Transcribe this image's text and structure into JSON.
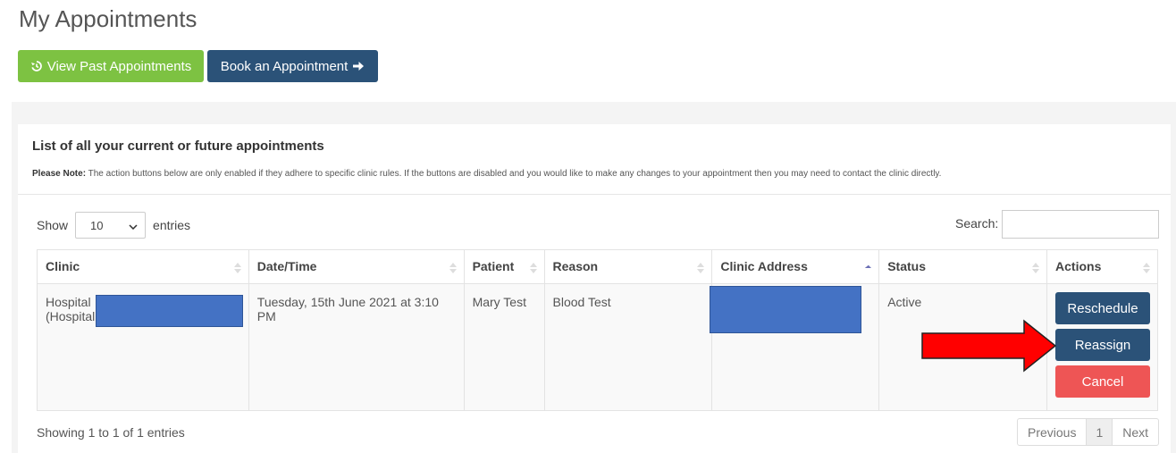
{
  "page": {
    "title": "My Appointments"
  },
  "toolbar": {
    "past_label": "View Past Appointments",
    "book_label": "Book an Appointment"
  },
  "panel": {
    "heading": "List of all your current or future appointments",
    "note_label": "Please Note:",
    "note_text": " The action buttons below are only enabled if they adhere to specific clinic rules. If the buttons are disabled and you would like to make any changes to your appointment then you may need to contact the clinic directly."
  },
  "length": {
    "show_label": "Show",
    "value": "10",
    "entries_label": "entries"
  },
  "search": {
    "label": "Search:",
    "value": ""
  },
  "table": {
    "columns": [
      "Clinic",
      "Date/Time",
      "Patient",
      "Reason",
      "Clinic Address",
      "Status",
      "Actions"
    ],
    "rows": [
      {
        "clinic_line1": "Hospital",
        "clinic_line2": "(Hospital",
        "datetime": "Tuesday, 15th June 2021 at 3:10 PM",
        "patient": "Mary Test",
        "reason": "Blood Test",
        "status": "Active"
      }
    ]
  },
  "actions": {
    "reschedule": "Reschedule",
    "reassign": "Reassign",
    "cancel": "Cancel"
  },
  "footer": {
    "showing": "Showing 1 to 1 of 1 entries"
  },
  "pagination": {
    "previous": "Previous",
    "current": "1",
    "next": "Next"
  },
  "colors": {
    "green": "#7dc242",
    "navy": "#2b5278",
    "red_button": "#ee5555",
    "redaction": "#4472c4",
    "arrow": "#ff0000"
  }
}
